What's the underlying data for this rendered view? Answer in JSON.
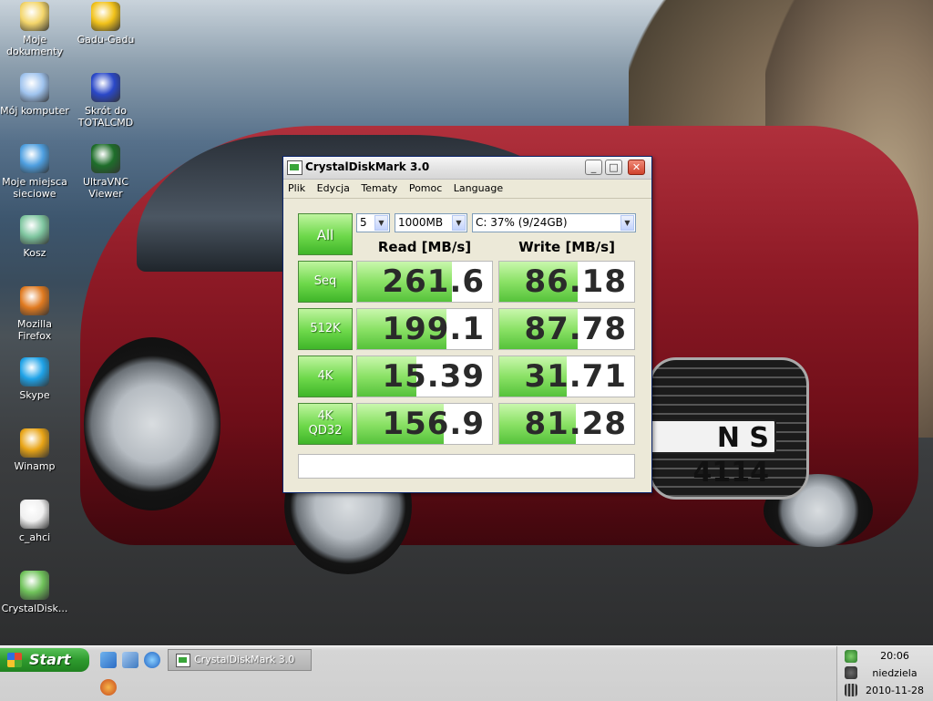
{
  "desktop": {
    "icons": [
      {
        "label_line1": "Moje",
        "label_line2": "dokumenty",
        "icon": "my-documents-icon",
        "color": "#f3d56a"
      },
      {
        "label_line1": "Gadu-Gadu",
        "label_line2": "",
        "icon": "gadu-gadu-icon",
        "color": "#f2c21a"
      },
      {
        "label_line1": "Mój komputer",
        "label_line2": "",
        "icon": "my-computer-icon",
        "color": "#9fc3ee"
      },
      {
        "label_line1": "Skrót do",
        "label_line2": "TOTALCMD",
        "icon": "totalcmd-icon",
        "color": "#2a48c8"
      },
      {
        "label_line1": "Moje miejsca",
        "label_line2": "sieciowe",
        "icon": "network-places-icon",
        "color": "#4e9fe0"
      },
      {
        "label_line1": "UltraVNC",
        "label_line2": "Viewer",
        "icon": "ultravnc-icon",
        "color": "#1e6e2a"
      },
      {
        "label_line1": "Kosz",
        "label_line2": "",
        "icon": "recycle-bin-icon",
        "color": "#7fc6a0"
      },
      {
        "label_line1": "Mozilla Firefox",
        "label_line2": "",
        "icon": "firefox-icon",
        "color": "#e07a20"
      },
      {
        "label_line1": "Skype",
        "label_line2": "",
        "icon": "skype-icon",
        "color": "#1fa3e8"
      },
      {
        "label_line1": "Winamp",
        "label_line2": "",
        "icon": "winamp-icon",
        "color": "#e8a416"
      },
      {
        "label_line1": "c_ahci",
        "label_line2": "",
        "icon": "file-icon",
        "color": "#f0f0f0"
      },
      {
        "label_line1": "CrystalDisk...",
        "label_line2": "",
        "icon": "crystaldisk-icon",
        "color": "#6fc25a"
      }
    ],
    "plate_text": "N S 4114"
  },
  "window": {
    "title": "CrystalDiskMark 3.0",
    "minimize": "_",
    "maximize": "□",
    "close": "✕",
    "menu": [
      "Plik",
      "Edycja",
      "Tematy",
      "Pomoc",
      "Language"
    ],
    "all_button": "All",
    "count_select": "5",
    "size_select": "1000MB",
    "drive_select": "C: 37% (9/24GB)",
    "read_header": "Read [MB/s]",
    "write_header": "Write [MB/s]",
    "rows": [
      {
        "label": "Seq",
        "read": "261.6",
        "write": "86.18",
        "read_fill": 0.7,
        "write_fill": 0.58
      },
      {
        "label": "512K",
        "read": "199.1",
        "write": "87.78",
        "read_fill": 0.66,
        "write_fill": 0.58
      },
      {
        "label": "4K",
        "read": "15.39",
        "write": "31.71",
        "read_fill": 0.44,
        "write_fill": 0.5
      },
      {
        "label": "4K\nQD32",
        "read": "156.9",
        "write": "81.28",
        "read_fill": 0.64,
        "write_fill": 0.57
      }
    ]
  },
  "taskbar": {
    "start_label": "Start",
    "task_button": "CrystalDiskMark 3.0",
    "clock_time": "20:06",
    "clock_day": "niedziela",
    "clock_date": "2010-11-28"
  }
}
